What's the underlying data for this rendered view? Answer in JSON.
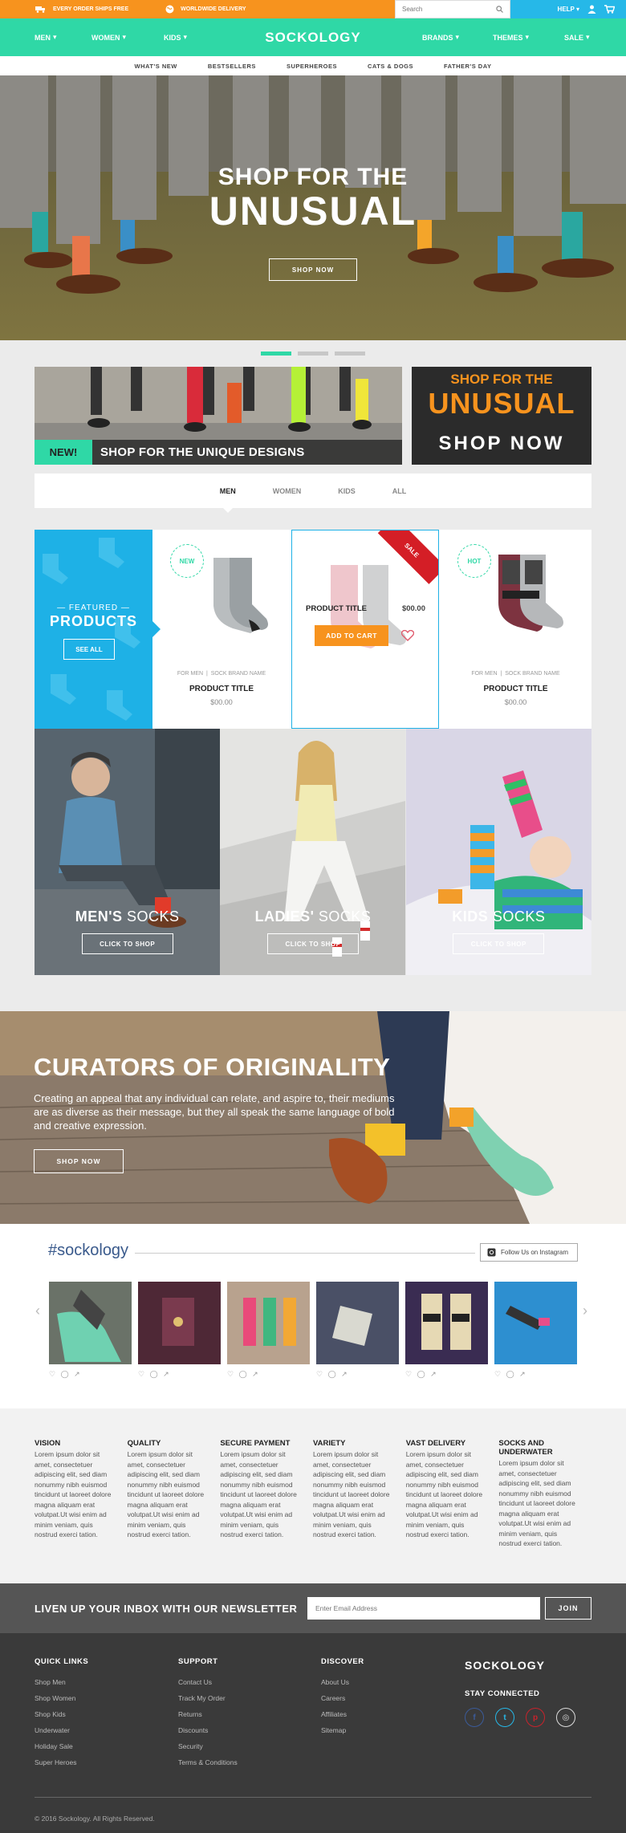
{
  "topbar": {
    "perk1": "EVERY ORDER SHIPS FREE",
    "perk2": "WORLDWIDE DELIVERY",
    "search_placeholder": "Search",
    "help": "HELP",
    "colors": {
      "orange": "#f7931e",
      "blue": "#26b8e8"
    }
  },
  "nav": {
    "logo": "SOCKOLOGY",
    "left": [
      "MEN",
      "WOMEN",
      "KIDS"
    ],
    "right": [
      "BRANDS",
      "THEMES",
      "SALE"
    ],
    "accent": "#2fd8a6"
  },
  "subnav": [
    "WHAT'S NEW",
    "BESTSELLERS",
    "SUPERHEROES",
    "CATS & DOGS",
    "FATHER'S DAY"
  ],
  "hero": {
    "line1": "SHOP FOR THE",
    "line2": "UNUSUAL",
    "button": "SHOP NOW",
    "slides": 3,
    "active_slide": 1
  },
  "promo_left": {
    "badge": "NEW!",
    "text": "SHOP FOR THE UNIQUE DESIGNS"
  },
  "promo_right": {
    "line1": "SHOP FOR THE",
    "line2": "UNUSUAL",
    "line3": "SHOP NOW"
  },
  "tabs": [
    "MEN",
    "WOMEN",
    "KIDS",
    "ALL"
  ],
  "active_tab": "MEN",
  "featured": {
    "label_top": "FEATURED",
    "label_main": "PRODUCTS",
    "button": "SEE ALL",
    "products": [
      {
        "badge": "NEW",
        "category": "FOR MEN",
        "brand": "SOCK BRAND NAME",
        "title": "PRODUCT TITLE",
        "price": "$00.00"
      },
      {
        "badge": "SALE",
        "title": "PRODUCT TITLE",
        "price": "$00.00",
        "button": "ADD TO CART"
      },
      {
        "badge": "HOT",
        "category": "FOR MEN",
        "brand": "SOCK BRAND NAME",
        "title": "PRODUCT TITLE",
        "price": "$00.00"
      }
    ]
  },
  "categories": [
    {
      "bold": "MEN'S",
      "thin": "SOCKS",
      "button": "CLICK TO SHOP"
    },
    {
      "bold": "LADIES'",
      "thin": "SOCKS",
      "button": "CLICK TO SHOP"
    },
    {
      "bold": "KIDS",
      "thin": "SOCKS",
      "button": "CLICK TO SHOP"
    }
  ],
  "curators": {
    "title": "CURATORS OF ORIGINALITY",
    "body": "Creating an appeal that any individual can relate, and aspire to, their mediums are as diverse as their message, but they all speak the same language of bold and creative expression.",
    "button": "SHOP NOW"
  },
  "instagram": {
    "hashtag": "#sockology",
    "follow": "Follow Us on Instagram"
  },
  "features": [
    {
      "title": "VISION",
      "text": "Lorem ipsum dolor sit amet, consectetuer adipiscing elit, sed diam nonummy nibh euismod tincidunt ut laoreet dolore magna aliquam erat volutpat.Ut wisi enim ad minim veniam, quis nostrud exerci tation."
    },
    {
      "title": "QUALITY",
      "text": "Lorem ipsum dolor sit amet, consectetuer adipiscing elit, sed diam nonummy nibh euismod tincidunt ut laoreet dolore magna aliquam erat volutpat.Ut wisi enim ad minim veniam, quis nostrud exerci tation."
    },
    {
      "title": "SECURE PAYMENT",
      "text": "Lorem ipsum dolor sit amet, consectetuer adipiscing elit, sed diam nonummy nibh euismod tincidunt ut laoreet dolore magna aliquam erat volutpat.Ut wisi enim ad minim veniam, quis nostrud exerci tation."
    },
    {
      "title": "VARIETY",
      "text": "Lorem ipsum dolor sit amet, consectetuer adipiscing elit, sed diam nonummy nibh euismod tincidunt ut laoreet dolore magna aliquam erat volutpat.Ut wisi enim ad minim veniam, quis nostrud exerci tation."
    },
    {
      "title": "VAST DELIVERY",
      "text": "Lorem ipsum dolor sit amet, consectetuer adipiscing elit, sed diam nonummy nibh euismod tincidunt ut laoreet dolore magna aliquam erat volutpat.Ut wisi enim ad minim veniam, quis nostrud exerci tation."
    },
    {
      "title": "SOCKS AND UNDERWATER",
      "text": "Lorem ipsum dolor sit amet, consectetuer adipiscing elit, sed diam nonummy nibh euismod tincidunt ut laoreet dolore magna aliquam erat volutpat.Ut wisi enim ad minim veniam, quis nostrud exerci tation."
    }
  ],
  "newsletter": {
    "title": "LIVEN UP YOUR INBOX WITH OUR NEWSLETTER",
    "placeholder": "Enter Email Address",
    "button": "JOIN"
  },
  "footer": {
    "quick_links": {
      "title": "QUICK LINKS",
      "items": [
        "Shop Men",
        "Shop Women",
        "Shop Kids",
        "Underwater",
        "Holiday Sale",
        "Super Heroes"
      ]
    },
    "support": {
      "title": "SUPPORT",
      "items": [
        "Contact Us",
        "Track My Order",
        "Returns",
        "Discounts",
        "Security",
        "Terms & Conditions"
      ]
    },
    "discover": {
      "title": "DISCOVER",
      "items": [
        "About Us",
        "Careers",
        "Affiliates",
        "Sitemap"
      ]
    },
    "logo": "SOCKOLOGY",
    "stay": "STAY CONNECTED",
    "social": [
      "facebook-icon",
      "twitter-icon",
      "pinterest-icon",
      "instagram-icon"
    ],
    "copyright": "© 2016 Sockology. All Rights Reserved."
  }
}
